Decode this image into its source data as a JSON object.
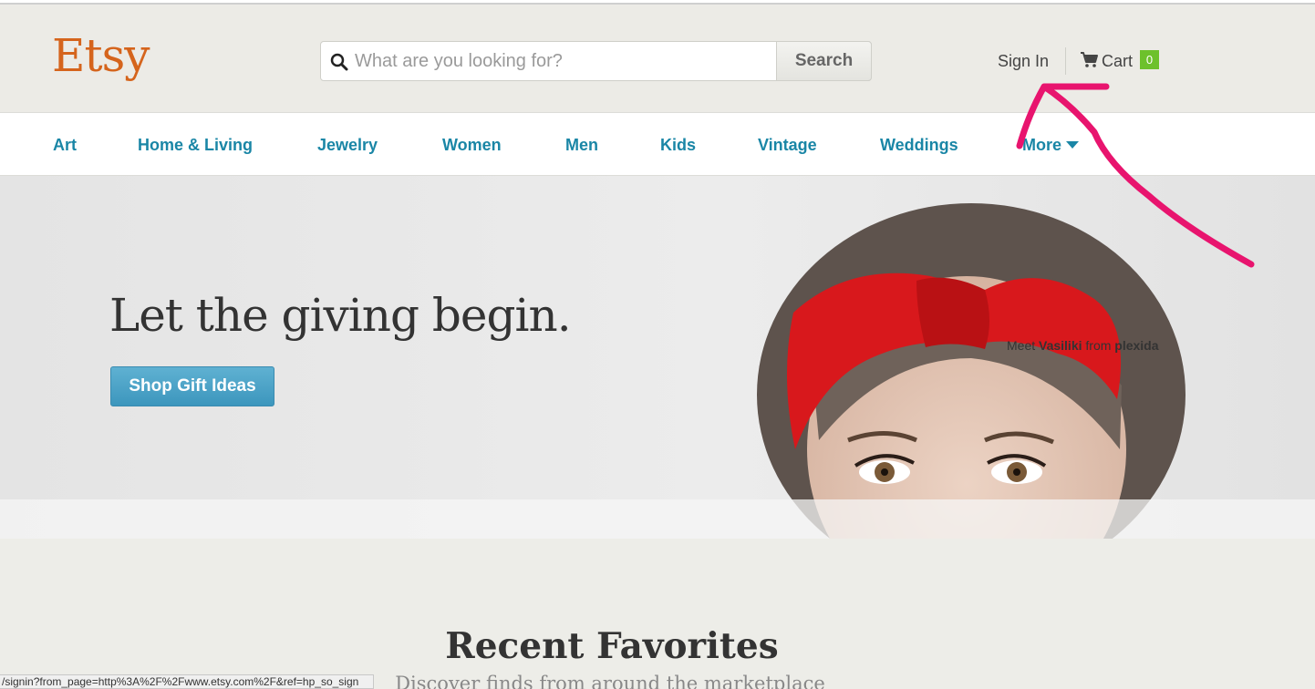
{
  "header": {
    "logo": "Etsy",
    "search": {
      "placeholder": "What are you looking for?",
      "value": "",
      "button_label": "Search"
    },
    "signin_label": "Sign In",
    "cart": {
      "label": "Cart",
      "count": "0"
    }
  },
  "nav": {
    "items": [
      "Art",
      "Home & Living",
      "Jewelry",
      "Women",
      "Men",
      "Kids",
      "Vintage",
      "Weddings",
      "More"
    ]
  },
  "hero": {
    "title": "Let the giving begin.",
    "button_label": "Shop Gift Ideas",
    "caption": {
      "prefix": "Meet",
      "person": "Vasiliki",
      "middle": "from",
      "shop": "plexida"
    }
  },
  "section": {
    "title": "Recent Favorites",
    "subtitle": "Discover finds from around the marketplace"
  },
  "status_bar": {
    "url": "/signin?from_page=http%3A%2F%2Fwww.etsy.com%2F&ref=hp_so_sign"
  },
  "colors": {
    "brand": "#d5641c",
    "nav_link": "#1a86a6",
    "cta": "#3c96bd",
    "cart_badge": "#6dc12c",
    "annotation": "#e8146e"
  }
}
